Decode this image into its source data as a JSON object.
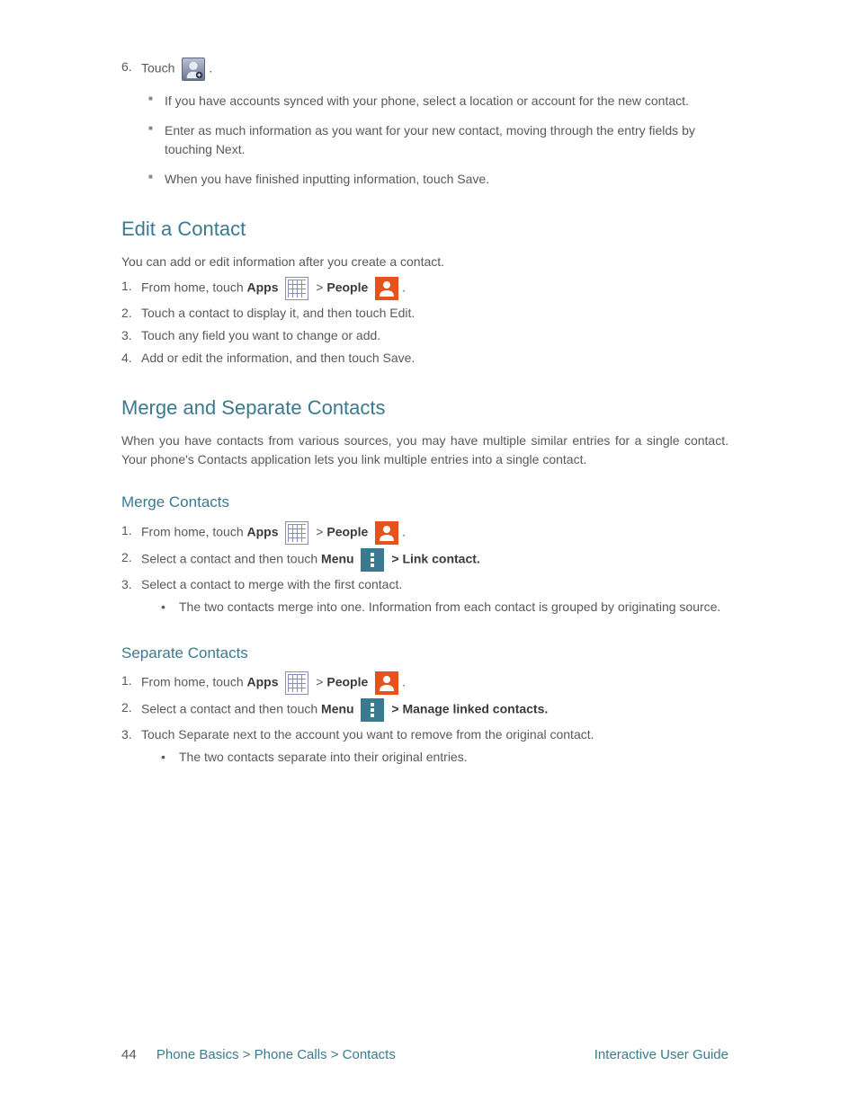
{
  "top_step": {
    "num": "6.",
    "prefix": "Touch ",
    "icon_label": "new-contact-icon",
    "suffix": "."
  },
  "bullets": [
    "If you have accounts synced with your phone, select a location or account for the new contact.",
    "Enter as much information as you want for your new contact, moving through the entry fields by touching Next.",
    "When you have finished inputting information, touch Save."
  ],
  "edit_contact": {
    "heading": "Edit a Contact",
    "intro": "You can add or edit information after you create a contact.",
    "steps": [
      {
        "num": "1.",
        "prefix": "From",
        "part1": " home, touch ",
        "apps": "Apps",
        "part2": " > ",
        "people": "People",
        "suffix": "."
      },
      {
        "num": "2.",
        "text": "Touch a contact to display it, and then touch Edit."
      },
      {
        "num": "3.",
        "text": "Touch any field you want to change or add."
      },
      {
        "num": "4.",
        "text": "Add or edit the information, and then touch Save."
      }
    ]
  },
  "merge": {
    "heading": "Merge and Separate Contacts",
    "intro": "When you have contacts from various sources, you may have multiple similar entries for a single contact. Your phone's Contacts application lets you link multiple entries into a single contact.",
    "merge_sub": {
      "heading": "Merge Contacts",
      "steps": [
        {
          "num": "1.",
          "prefix": "From",
          "part1": " home, touch ",
          "apps": "Apps",
          "part2": " > ",
          "people": "People",
          "suffix": "."
        },
        {
          "num": "2.",
          "prefix": "Select a contact and then touch ",
          "menu": "Menu",
          "suffix": " > Link contact."
        },
        {
          "num": "3.",
          "text": "Select a contact to merge with the first contact.",
          "sub": [
            {
              "snum": "•",
              "stext": "The two contacts merge into one. Information from each contact is grouped by originating source."
            }
          ]
        }
      ]
    },
    "separate_sub": {
      "heading": "Separate Contacts",
      "steps": [
        {
          "num": "1.",
          "prefix": "From",
          "part1": " home, touch ",
          "apps": "Apps",
          "part2": " > ",
          "people": "People",
          "suffix": "."
        },
        {
          "num": "2.",
          "prefix": "Select a contact and then touch ",
          "menu": "Menu",
          "suffix": " > Manage linked contacts."
        },
        {
          "num": "3.",
          "text": "Touch Separate next to the account you want to remove from the original contact.",
          "sub": [
            {
              "snum": "•",
              "stext": "The two contacts separate into their original entries."
            }
          ]
        }
      ]
    }
  },
  "footer": {
    "page_num": "44",
    "section_chain": "Phone Basics > Phone Calls > Contacts",
    "guide_title": "Interactive User Guide"
  }
}
